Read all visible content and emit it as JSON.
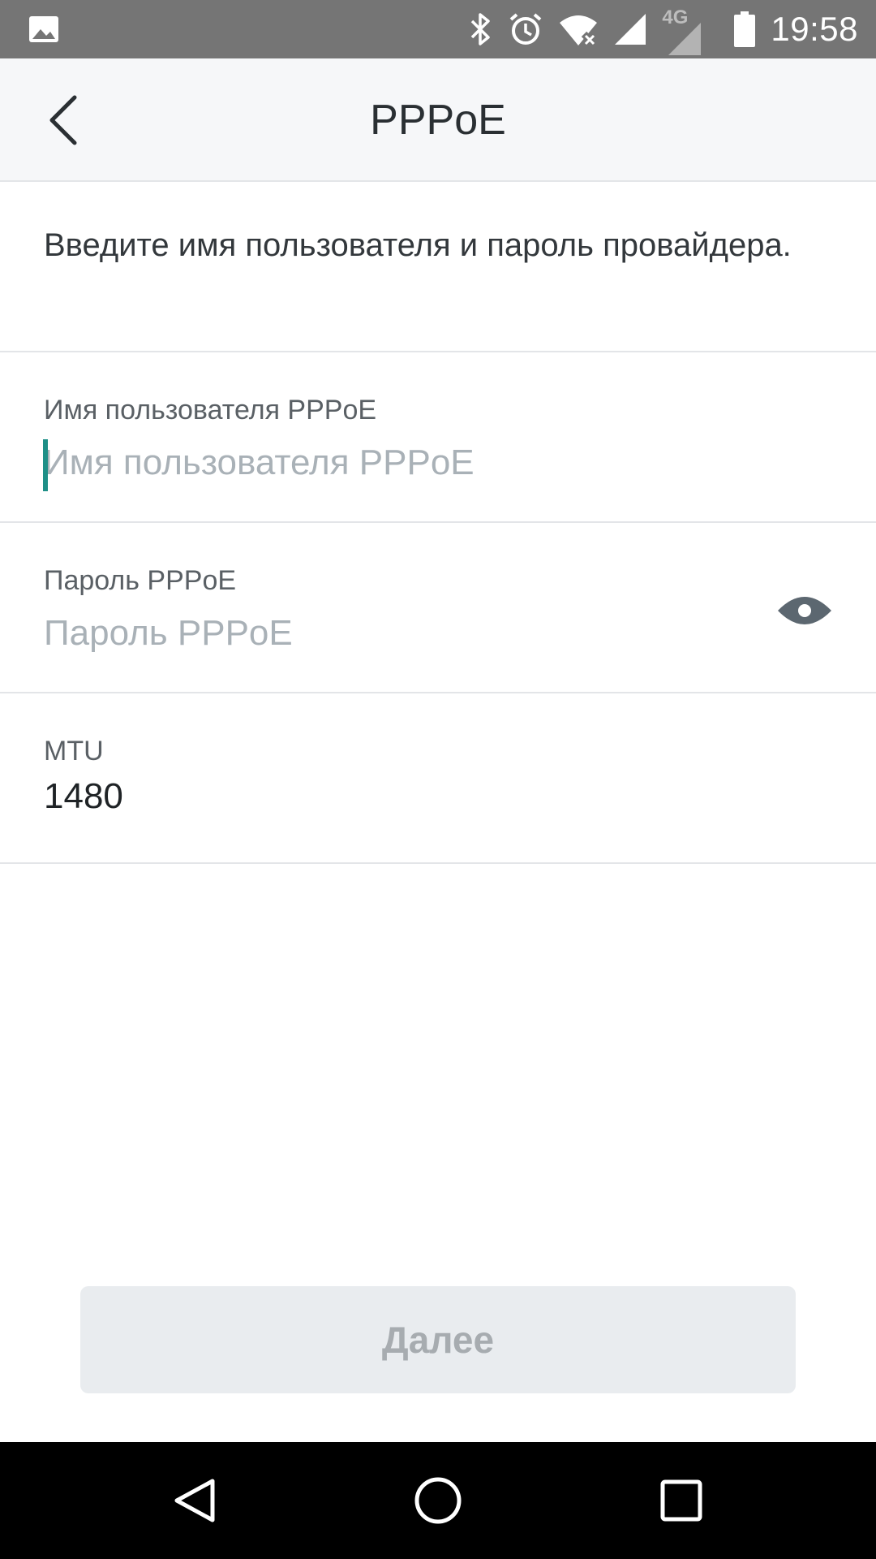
{
  "status_bar": {
    "time": "19:58",
    "network_label": "4G",
    "icons": [
      "image-icon",
      "bluetooth-icon",
      "alarm-icon",
      "wifi-off-icon",
      "signal-icon",
      "signal-4g-icon",
      "battery-icon"
    ]
  },
  "app_bar": {
    "title": "PPPoE",
    "back_icon": "chevron-left-icon"
  },
  "intro": {
    "text": "Введите имя пользователя и пароль провайдера."
  },
  "form": {
    "username": {
      "label": "Имя пользователя PPPoE",
      "placeholder": "Имя пользователя PPPoE",
      "value": ""
    },
    "password": {
      "label": "Пароль PPPoE",
      "placeholder": "Пароль PPPoE",
      "value": "",
      "toggle_icon": "eye-icon"
    },
    "mtu": {
      "label": "MTU",
      "value": "1480"
    }
  },
  "next_button": {
    "label": "Далее",
    "enabled": false
  },
  "nav_bar": {
    "icons": [
      "back-triangle-icon",
      "home-circle-icon",
      "recents-square-icon"
    ]
  },
  "colors": {
    "status_bar": "#757575",
    "app_bar": "#f6f7f9",
    "accent_caret": "#1e8f87",
    "button_disabled_bg": "#e9ecef",
    "button_disabled_text": "#a7acb0"
  }
}
